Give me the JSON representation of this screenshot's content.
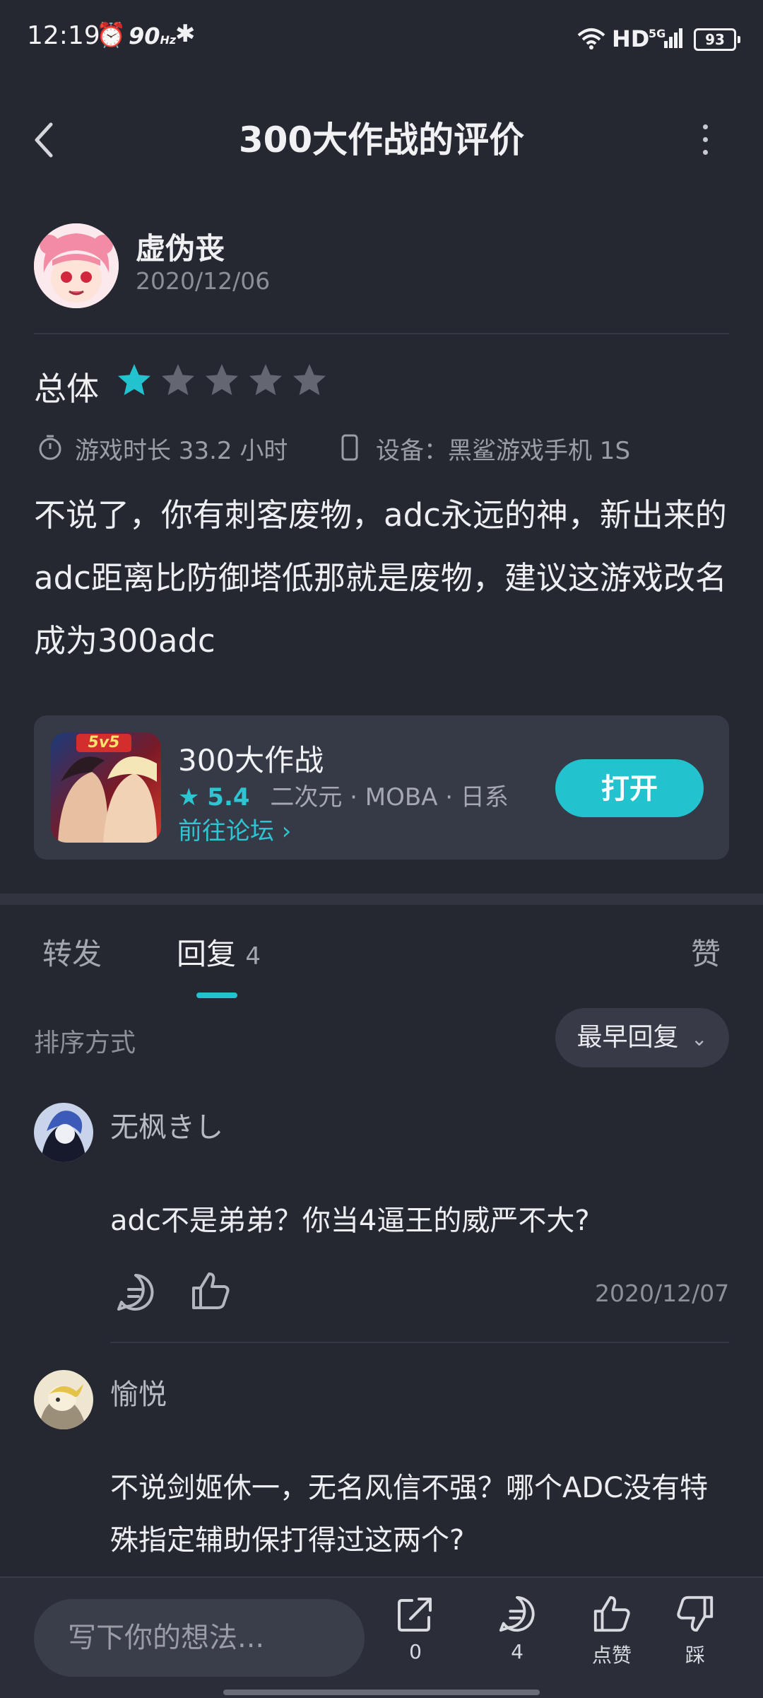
{
  "status_bar": {
    "time": "12:19",
    "refresh": "90",
    "refresh_unit": "Hz",
    "network": "HD",
    "gen": "5G",
    "battery": "93"
  },
  "header": {
    "title": "300大作战的评价"
  },
  "review": {
    "author": "虚伪丧",
    "date": "2020/12/06",
    "overall_label": "总体",
    "rating": 1,
    "rating_max": 5,
    "playtime": "游戏时长 33.2 小时",
    "device": "设备：黑鲨游戏手机 1S",
    "text": "不说了，你有刺客废物，adc永远的神，新出来的adc距离比防御塔低那就是废物，建议这游戏改名成为300adc"
  },
  "game_card": {
    "name": "300大作战",
    "badge": "5v5",
    "rating": "5.4",
    "tags": "二次元 · MOBA · 日系",
    "forum_link": "前往论坛",
    "open_button": "打开"
  },
  "tabs": {
    "forward": "转发",
    "reply": "回复",
    "reply_count": "4",
    "like": "赞"
  },
  "sort": {
    "label": "排序方式",
    "selected": "最早回复"
  },
  "comments": [
    {
      "name": "无枫きし",
      "text": "adc不是弟弟？你当4逼王的威严不大?",
      "date": "2020/12/07"
    },
    {
      "name": "愉悦",
      "text": "不说剑姬休一，无名风信不强？哪个ADC没有特殊指定辅助保打得过这两个?"
    }
  ],
  "bottom_bar": {
    "input_placeholder": "写下你的想法...",
    "share_count": "0",
    "comment_count": "4",
    "like_label": "点赞",
    "dislike_label": "踩"
  },
  "colors": {
    "accent": "#22c3cf",
    "background": "#252731",
    "card": "#363a47"
  }
}
